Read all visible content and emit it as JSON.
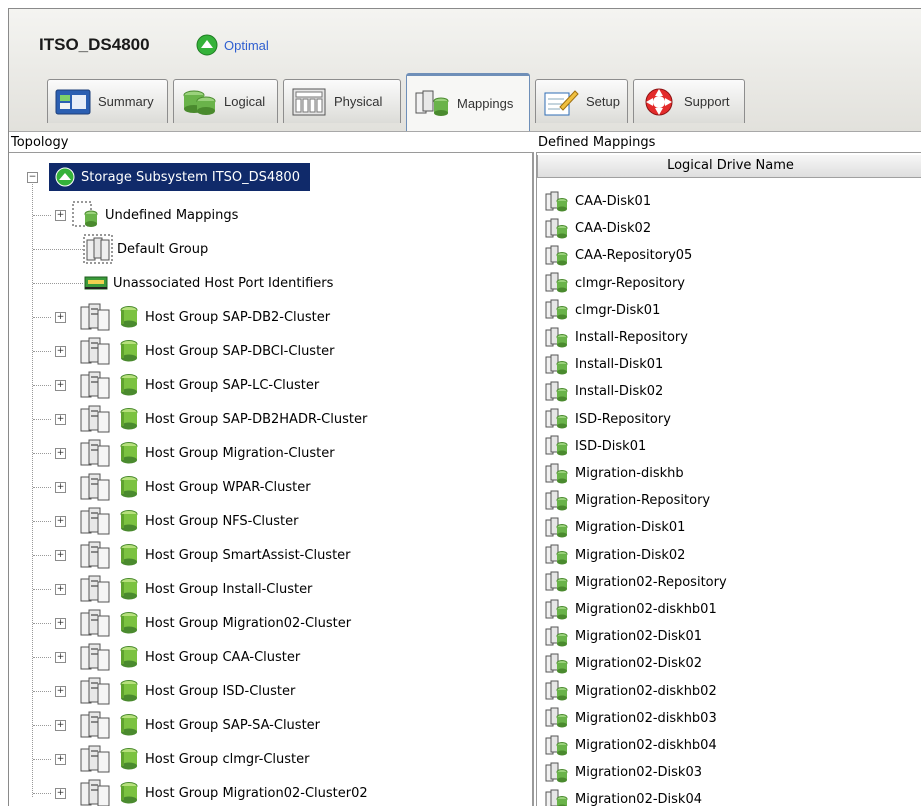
{
  "app": {
    "title": "ITSO_DS4800",
    "status": "Optimal",
    "status_color": "#35b23a"
  },
  "tabs": [
    {
      "label": "Summary",
      "icon": "summary-icon"
    },
    {
      "label": "Logical",
      "icon": "logical-icon"
    },
    {
      "label": "Physical",
      "icon": "physical-icon"
    },
    {
      "label": "Mappings",
      "icon": "mappings-icon",
      "active": true
    },
    {
      "label": "Setup",
      "icon": "setup-icon"
    },
    {
      "label": "Support",
      "icon": "support-icon"
    }
  ],
  "topology": {
    "heading": "Topology",
    "root": "Storage Subsystem ITSO_DS4800",
    "undefined": "Undefined Mappings",
    "default_group": "Default Group",
    "unassociated": "Unassociated Host Port Identifiers",
    "host_groups": [
      "Host Group SAP-DB2-Cluster",
      "Host Group SAP-DBCI-Cluster",
      "Host Group SAP-LC-Cluster",
      "Host Group SAP-DB2HADR-Cluster",
      "Host Group Migration-Cluster",
      "Host Group WPAR-Cluster",
      "Host Group NFS-Cluster",
      "Host Group SmartAssist-Cluster",
      "Host Group Install-Cluster",
      "Host Group Migration02-Cluster",
      "Host Group CAA-Cluster",
      "Host Group ISD-Cluster",
      "Host Group SAP-SA-Cluster",
      "Host Group clmgr-Cluster",
      "Host Group Migration02-Cluster02"
    ]
  },
  "mappings": {
    "heading": "Defined Mappings",
    "column": "Logical Drive Name",
    "drives": [
      "CAA-Disk01",
      "CAA-Disk02",
      "CAA-Repository05",
      "clmgr-Repository",
      "clmgr-Disk01",
      "Install-Repository",
      "Install-Disk01",
      "Install-Disk02",
      "ISD-Repository",
      "ISD-Disk01",
      "Migration-diskhb",
      "Migration-Repository",
      "Migration-Disk01",
      "Migration-Disk02",
      "Migration02-Repository",
      "Migration02-diskhb01",
      "Migration02-Disk01",
      "Migration02-Disk02",
      "Migration02-diskhb02",
      "Migration02-diskhb03",
      "Migration02-diskhb04",
      "Migration02-Disk03",
      "Migration02-Disk04"
    ]
  }
}
